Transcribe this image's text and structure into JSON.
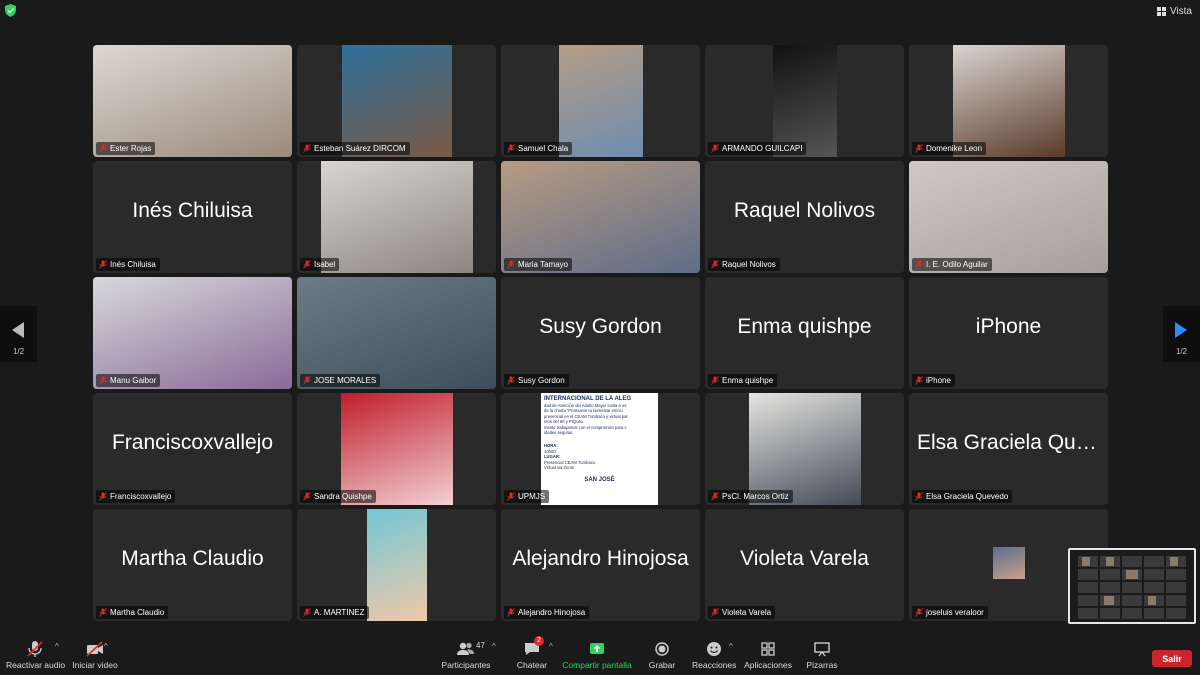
{
  "topbar": {
    "view_label": "Vista"
  },
  "participants": [
    {
      "label": "Ester Rojas",
      "big": "",
      "video": true
    },
    {
      "label": "Esteban Suárez DIRCOM",
      "big": "",
      "video": true
    },
    {
      "label": "Samuel Chala",
      "big": "",
      "video": true
    },
    {
      "label": "ARMANDO GUILCAPI",
      "big": "",
      "video": true
    },
    {
      "label": "Domenike Leon",
      "big": "",
      "video": true
    },
    {
      "label": "Inés Chiluisa",
      "big": "Inés Chiluisa",
      "video": false
    },
    {
      "label": "Isabel",
      "big": "",
      "video": true
    },
    {
      "label": "Maria Tamayo",
      "big": "",
      "video": true
    },
    {
      "label": "Raquel Nolivos",
      "big": "Raquel Nolivos",
      "video": false
    },
    {
      "label": "I. E. Odilo Aguilar",
      "big": "",
      "video": true
    },
    {
      "label": "Manu Gaibor",
      "big": "",
      "video": true,
      "active": true
    },
    {
      "label": "JOSE MORALES",
      "big": "",
      "video": true
    },
    {
      "label": "Susy Gordon",
      "big": "Susy Gordon",
      "video": false
    },
    {
      "label": "Enma quishpe",
      "big": "Enma quishpe",
      "video": false
    },
    {
      "label": "iPhone",
      "big": "iPhone",
      "video": false
    },
    {
      "label": "Franciscoxvallejo",
      "big": "Franciscoxvallejo",
      "video": false
    },
    {
      "label": "Sandra Quishpe",
      "big": "",
      "video": true
    },
    {
      "label": "UPMJS",
      "big": "",
      "video": true,
      "poster": true
    },
    {
      "label": "PsCl. Marcos Ortiz",
      "big": "",
      "video": true
    },
    {
      "label": "Elsa Graciela Quevedo",
      "big": "Elsa Graciela Que...",
      "video": false
    },
    {
      "label": "Martha Claudio",
      "big": "Martha Claudio",
      "video": false
    },
    {
      "label": "A. MARTINEZ",
      "big": "",
      "video": true
    },
    {
      "label": "Alejandro Hinojosa",
      "big": "Alejandro Hinojosa",
      "video": false
    },
    {
      "label": "Violeta Varela",
      "big": "Violeta Varela",
      "video": false
    },
    {
      "label": "joseluis veraloor",
      "big": "",
      "video": true
    }
  ],
  "poster": {
    "title": "INTERNACIONAL DE LA ALEG",
    "line1": "dad de Atención del Adulto Mayor invita a us",
    "line2": "de la charla \"Promueve tu bienestar emoci",
    "line3": "presencial en el CEAM Tumbaco y virtual par",
    "line4": "ntos del 60 y PIQuito.",
    "line5": "mente trabajamos con el compromiso para c",
    "line6": "idades seguras.",
    "hora_label": "HORA:",
    "hora_value": "10h00",
    "lugar_label": "LUGAR:",
    "lugar_value": "Presencial CEAM Tumbaco",
    "lugar_value2": "Virtual via Zoom",
    "footer": "SAN JOSÉ"
  },
  "pagination": {
    "left": "1/2",
    "right": "1/2"
  },
  "toolbar": {
    "audio": "Reactivar audio",
    "video": "Iniciar video",
    "participants": "Participantes",
    "participants_count": "47",
    "chat": "Chatear",
    "chat_badge": "2",
    "share": "Compartir pantalla",
    "record": "Grabar",
    "reactions": "Reacciones",
    "apps": "Aplicaciones",
    "whiteboards": "Pizarras",
    "leave": "Salir"
  },
  "colors": {
    "accent_green": "#2fd35b",
    "active_speaker": "#3ec24a",
    "leave_red": "#c8252c",
    "mic_muted": "#e02828"
  }
}
